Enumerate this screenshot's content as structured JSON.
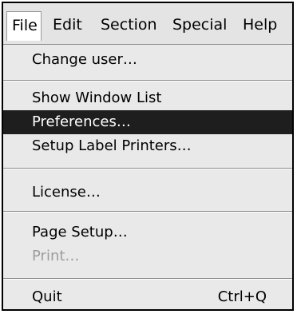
{
  "menubar": {
    "items": [
      {
        "label": "File"
      },
      {
        "label": "Edit"
      },
      {
        "label": "Section"
      },
      {
        "label": "Special"
      },
      {
        "label": "Help"
      }
    ]
  },
  "file_menu": {
    "items": [
      {
        "label": "Change user…"
      },
      {
        "label": "Show Window List"
      },
      {
        "label": "Preferences…",
        "state": "highlighted"
      },
      {
        "label": "Setup Label Printers…"
      },
      {
        "label": "License…"
      },
      {
        "label": "Page Setup…"
      },
      {
        "label": "Print…",
        "state": "disabled"
      },
      {
        "label": "Quit",
        "shortcut": "Ctrl+Q"
      }
    ]
  },
  "colors": {
    "highlight_bg": "#1e1e1e",
    "highlight_text": "#ffffff",
    "disabled_text": "#9c9c9c",
    "menu_bg": "#e9e9e9"
  }
}
